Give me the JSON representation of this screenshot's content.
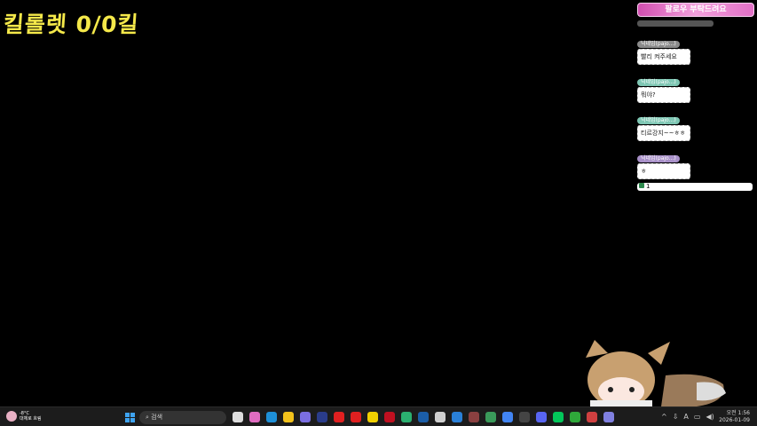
{
  "overlay": {
    "kill_counter": "킬롤렛 0/0킬"
  },
  "chat": {
    "follow_banner": "팔로우 부탁드려요",
    "messages": [
      {
        "nick": "닉네임(pajo...)",
        "text": "빨리 켜주세요",
        "color": "#8a8a8a"
      },
      {
        "nick": "닉네임(pajo...)",
        "text": "뭐야?",
        "color": "#7fc7b4"
      },
      {
        "nick": "닉네임(pajo...)",
        "text": "티르강지~~ㅎㅎ",
        "color": "#7fc7b4"
      },
      {
        "nick": "닉네임(pajo...)",
        "text": "ㅎ",
        "color": "#a890c8"
      }
    ],
    "viewer_count": "1"
  },
  "taskbar": {
    "weather_temp": "-8°C",
    "weather_desc": "대체로 흐림",
    "search_placeholder": "검색",
    "apps": [
      "#ddd",
      "#e06cc0",
      "#1e90d8",
      "#f3c21b",
      "#7a6ee0",
      "#2a3c8a",
      "#e02020",
      "#e02020",
      "#f0d000",
      "#c01020",
      "#2bb070",
      "#1b5ea8",
      "#d0d0d0",
      "#2a80d8",
      "#8a4040",
      "#3a9a5a",
      "#4285f4",
      "#444",
      "#5865f2",
      "#03c75a",
      "#2fa83a",
      "#d04040",
      "#8080e0"
    ],
    "time": "오전 1:56",
    "date": "2026-01-09",
    "ime": "A"
  }
}
